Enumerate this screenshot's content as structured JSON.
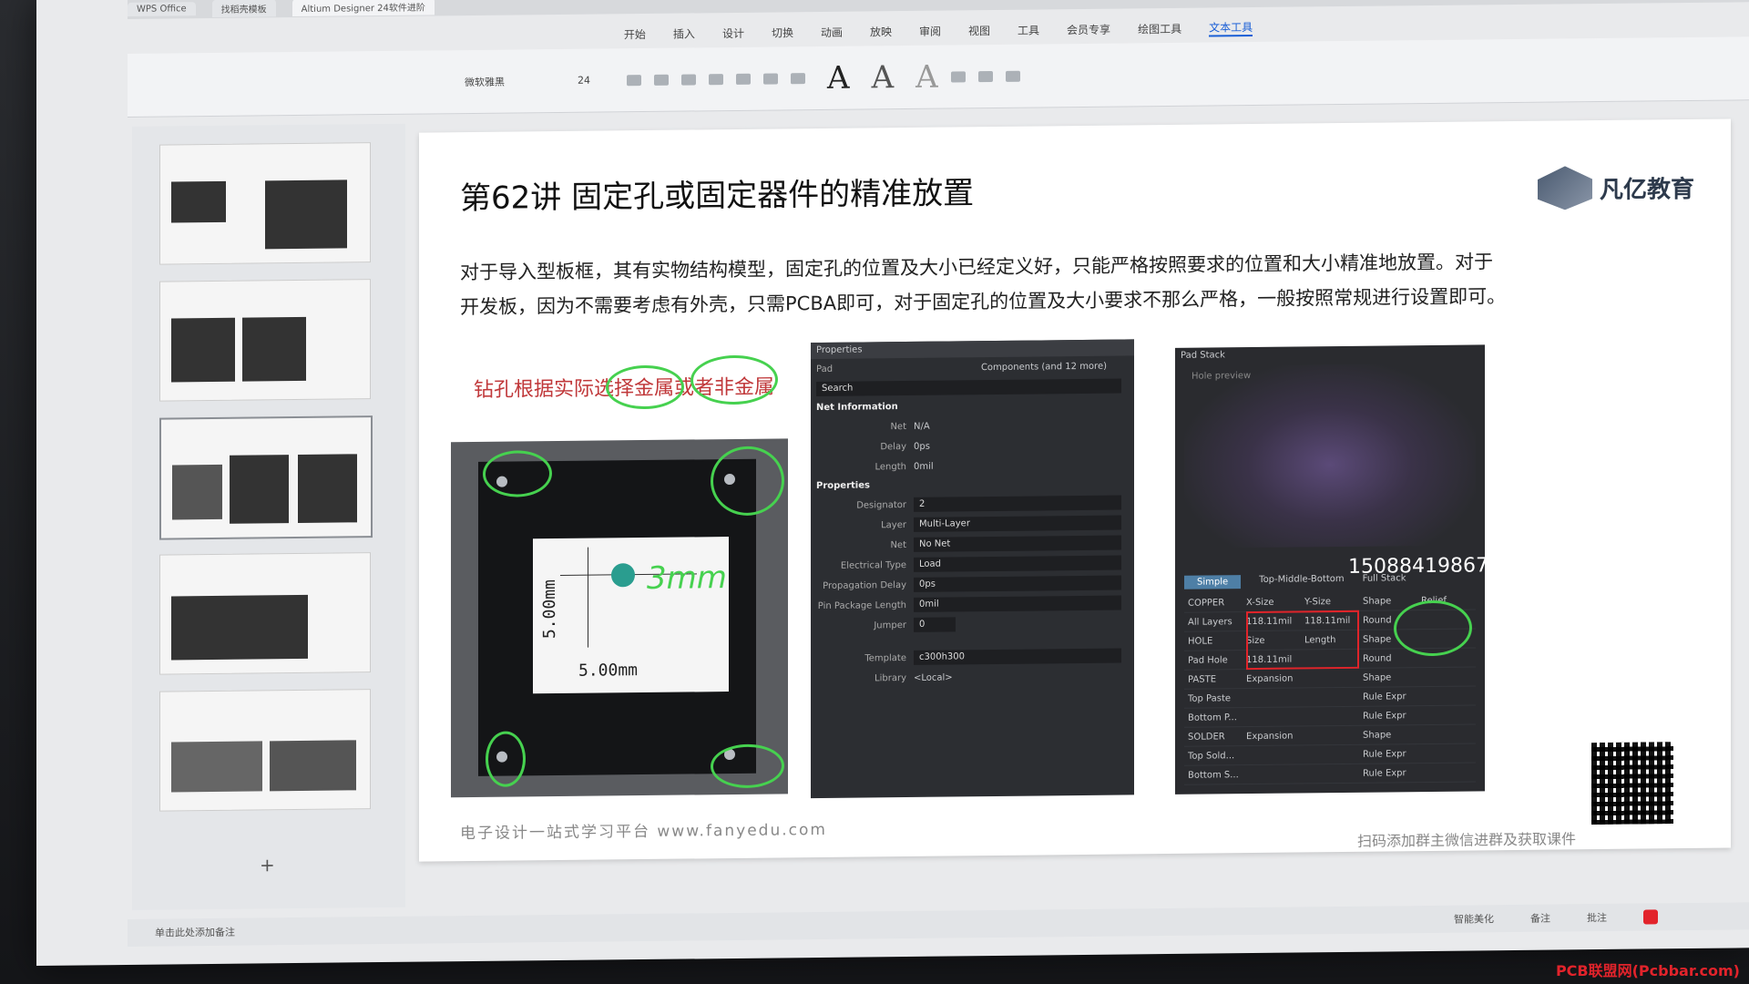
{
  "app": {
    "tabs": [
      "WPS Office",
      "找稻壳模板",
      "Altium Designer 24软件进阶"
    ],
    "menu": [
      "开始",
      "插入",
      "设计",
      "切换",
      "动画",
      "放映",
      "审阅",
      "视图",
      "工具",
      "会员专享",
      "绘图工具",
      "文本工具"
    ],
    "active_menu": "文本工具",
    "font_name": "微软雅黑",
    "font_size": "24"
  },
  "slide": {
    "title": "第62讲 固定孔或固定器件的精准放置",
    "logo_text": "凡亿教育",
    "body_line1": "对于导入型板框，其有实物结构模型，固定孔的位置及大小已经定义好，只能严格按照要求的位置和大小精准地放置。对于",
    "body_line2": "开发板，因为不需要考虑有外壳，只需PCBA即可，对于固定孔的位置及大小要求不那么严格，一般按照常规进行设置即可。",
    "note": "钻孔根据实际选择金属或者非金属",
    "pcb_dim_v": "5.00mm",
    "pcb_dim_h": "5.00mm",
    "hand_note": "3mm",
    "footer": "电子设计一站式学习平台 www.fanyedu.com",
    "qr_caption": "扫码添加群主微信进群及获取课件"
  },
  "properties_panel": {
    "header": "Properties",
    "type": "Pad",
    "filter": "Components (and 12 more)",
    "search_placeholder": "Search",
    "sec_net": "Net Information",
    "net_label": "Net",
    "net_value": "N/A",
    "delay_label": "Delay",
    "delay_value": "0ps",
    "length_label": "Length",
    "length_value": "0mil",
    "sec_props": "Properties",
    "designator_label": "Designator",
    "designator_value": "2",
    "layer_label": "Layer",
    "layer_value": "Multi-Layer",
    "net2_label": "Net",
    "net2_value": "No Net",
    "etype_label": "Electrical Type",
    "etype_value": "Load",
    "pdelay_label": "Propagation Delay",
    "pdelay_value": "0ps",
    "plen_label": "Pin Package Length",
    "plen_value": "0mil",
    "jumper_label": "Jumper",
    "jumper_value": "0",
    "template_label": "Template",
    "template_value": "c300h300",
    "library_label": "Library",
    "library_value": "<Local>"
  },
  "pad_stack": {
    "header": "Pad Stack",
    "preview_label": "Hole preview",
    "phone": "15088419867",
    "tab_simple": "Simple",
    "tab_tmb": "Top-Middle-Bottom",
    "tab_full": "Full Stack",
    "col_copper": "COPPER",
    "col_xsize": "X-Size",
    "col_ysize": "Y-Size",
    "col_shape": "Shape",
    "col_relief": "Relief",
    "row_all_layers": "All Layers",
    "x_size": "118.11mil",
    "y_size": "118.11mil",
    "shape": "Round",
    "col_hole": "HOLE",
    "col_size": "Size",
    "col_length": "Length",
    "row_pad_hole": "Pad Hole",
    "hole_size": "118.11mil",
    "col_paste": "PASTE",
    "col_expansion": "Expansion",
    "row_top_paste": "Top Paste",
    "row_bottom_paste": "Bottom P...",
    "rule_expr": "Rule Expr",
    "col_solder": "SOLDER",
    "row_top_solder": "Top Sold...",
    "row_bottom_solder": "Bottom S..."
  },
  "status": {
    "left": "单击此处添加备注",
    "smart": "智能美化",
    "notes": "备注",
    "comment": "批注"
  },
  "watermark": "PCB联盟网(Pcbbar.com)",
  "colors": {
    "accent": "#1a5fd6",
    "annotation_green": "#46d14f",
    "note_red": "#c0383a",
    "highlight_red": "#e0242a"
  }
}
